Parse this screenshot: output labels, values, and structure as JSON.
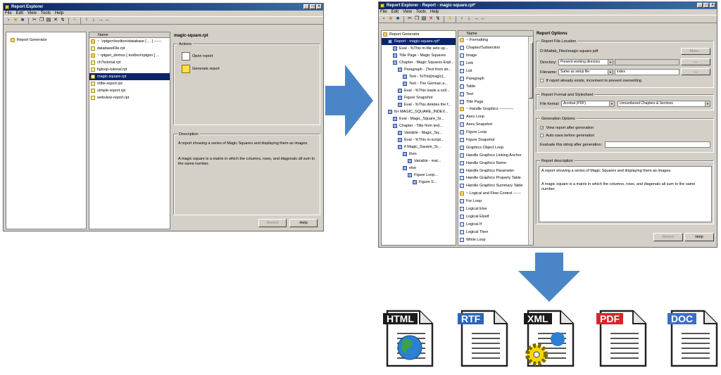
{
  "left_window": {
    "title": "Report Explorer",
    "menu": [
      "File",
      "Edit",
      "View",
      "Tools",
      "Help"
    ],
    "tree": [
      {
        "label": "Report Generator"
      }
    ],
    "list_header": "Name",
    "files": [
      {
        "name": "~ .\\rptgen\\toolbox\\database [ ... ] ------",
        "icon": "folder"
      },
      {
        "name": "databaseFile.rpt",
        "icon": "rpt"
      },
      {
        "name": "~ rptgen_demos [ toolbox\\rptgen ] ...",
        "icon": "folder"
      },
      {
        "name": "ch7tutorial.rpt",
        "icon": "rpt"
      },
      {
        "name": "figloop-tutorial.rpt",
        "icon": "rpt"
      },
      {
        "name": "magic-square.rpt",
        "icon": "rpt",
        "selected": true
      },
      {
        "name": "mfile-report.rpt",
        "icon": "rpt"
      },
      {
        "name": "simple-report.rpt",
        "icon": "rpt"
      },
      {
        "name": "webview-report.rpt",
        "icon": "rpt"
      }
    ],
    "detail_title": "magic-square.rpt",
    "actions_label": "Actions",
    "actions": [
      "Open report",
      "Generate report"
    ],
    "description_label": "Description",
    "description": [
      "A report showing a series of Magic Squares and displaying them as images.",
      "A magic square is a matrix in which the columns, rows, and diagonals all sum to the same number."
    ],
    "buttons": {
      "revert": "Revert",
      "help": "Help"
    }
  },
  "right_window": {
    "title": "Report Explorer - Report - magic-square.rpt*",
    "menu": [
      "File",
      "Edit",
      "View",
      "Tools",
      "Help"
    ],
    "tree": [
      {
        "label": "Report Generator",
        "indent": 0
      },
      {
        "label": "Report - magic-square.rpt*",
        "indent": 1,
        "selected": true
      },
      {
        "label": "Eval - %This m-file sets up...",
        "indent": 2
      },
      {
        "label": "Title Page - Magic Squares",
        "indent": 2
      },
      {
        "label": "Chapter - Magic Squares Expl...",
        "indent": 2
      },
      {
        "label": "Paragraph - (Text from str...",
        "indent": 3
      },
      {
        "label": "Text - %This[magic]...",
        "indent": 4
      },
      {
        "label": "Text - The German a...",
        "indent": 4
      },
      {
        "label": "Eval - %This loads a cell...",
        "indent": 3
      },
      {
        "label": "Figure Snapshot",
        "indent": 3
      },
      {
        "label": "Eval - %This deletes the f...",
        "indent": 3
      },
      {
        "label": "for MAGIC_SQUARE_INDEX...",
        "indent": 1
      },
      {
        "label": "Eval - Magic_Square_Si...",
        "indent": 2
      },
      {
        "label": "Chapter - Title from text...",
        "indent": 2
      },
      {
        "label": "Variable - Magic_Sq...",
        "indent": 3
      },
      {
        "label": "Eval - %This m-script...",
        "indent": 3
      },
      {
        "label": "if Magic_Square_Si...",
        "indent": 3
      },
      {
        "label": "then",
        "indent": 4
      },
      {
        "label": "Variable - mat...",
        "indent": 5
      },
      {
        "label": "else",
        "indent": 4
      },
      {
        "label": "Figure Loop...",
        "indent": 5
      },
      {
        "label": "Figure S...",
        "indent": 6
      }
    ],
    "list_header": "Name",
    "components": [
      {
        "name": "~ Formatting",
        "icon": "folder"
      },
      {
        "name": "Chapter/Subsection",
        "icon": "doc"
      },
      {
        "name": "Image",
        "icon": "doc"
      },
      {
        "name": "Link",
        "icon": "doc"
      },
      {
        "name": "List",
        "icon": "doc"
      },
      {
        "name": "Paragraph",
        "icon": "doc"
      },
      {
        "name": "Table",
        "icon": "doc"
      },
      {
        "name": "Text",
        "icon": "doc"
      },
      {
        "name": "Title Page",
        "icon": "doc"
      },
      {
        "name": "~ Handle Graphics -----------",
        "icon": "folder"
      },
      {
        "name": "Axes Loop",
        "icon": "doc"
      },
      {
        "name": "Axes Snapshot",
        "icon": "doc"
      },
      {
        "name": "Figure Loop",
        "icon": "doc"
      },
      {
        "name": "Figure Snapshot",
        "icon": "doc"
      },
      {
        "name": "Graphics Object Loop",
        "icon": "doc"
      },
      {
        "name": "Handle Graphics Linking Anchor",
        "icon": "doc"
      },
      {
        "name": "Handle Graphics Name",
        "icon": "doc"
      },
      {
        "name": "Handle Graphics Parameter",
        "icon": "doc"
      },
      {
        "name": "Handle Graphics Property Table",
        "icon": "doc"
      },
      {
        "name": "Handle Graphics Summary Table",
        "icon": "doc"
      },
      {
        "name": "~ Logical and Flow Control ------",
        "icon": "folder"
      },
      {
        "name": "For Loop",
        "icon": "doc"
      },
      {
        "name": "Logical Else",
        "icon": "doc"
      },
      {
        "name": "Logical Elseif",
        "icon": "doc"
      },
      {
        "name": "Logical If",
        "icon": "doc"
      },
      {
        "name": "Logical Then",
        "icon": "doc"
      },
      {
        "name": "While Loop",
        "icon": "doc"
      }
    ],
    "options": {
      "title": "Report Options",
      "file_location_label": "Report File Location",
      "path": "D:\\Matlab_Files\\magic-square.pdf",
      "more_btn": "More...",
      "directory_label": "Directory:",
      "directory_value": "Present working directory",
      "filename_label": "Filename:",
      "filename_value": "Same as setup file",
      "filename_text": "index",
      "browse_btn": "...",
      "overwrite_label": "If report already exists, increment to prevent overwriting",
      "format_label": "Report Format and Stylesheet",
      "file_format_label": "File format:",
      "file_format_value": "Acrobat (PDF)",
      "stylesheet_value": "Unnumbered Chapters & Sections",
      "generation_label": "Generation Options",
      "view_after": "View report after generation",
      "auto_save": "Auto save before generation",
      "evaluate": "Evaluate this string after generation:",
      "description_label": "Report description",
      "description": [
        "A report showing a series of Magic Squares and displaying them as images.",
        "A magic square is a matrix in which the columns, rows, and diagonals all sum to the same number."
      ],
      "revert_btn": "Revert",
      "help_btn": "Help"
    }
  },
  "outputs": [
    {
      "label": "HTML",
      "color": "#1b1b1b",
      "icon": "globe-icon"
    },
    {
      "label": "RTF",
      "color": "#2f66b5",
      "icon": "document-icon"
    },
    {
      "label": "XML",
      "color": "#1b1b1b",
      "icon": "gear-icon"
    },
    {
      "label": "PDF",
      "color": "#d8242b",
      "icon": "document-icon"
    },
    {
      "label": "DOC",
      "color": "#3c6fc4",
      "icon": "document-icon"
    }
  ],
  "colors": {
    "arrow": "#4a86c7",
    "selection": "#0a246a",
    "window_face": "#d4d0c8"
  }
}
